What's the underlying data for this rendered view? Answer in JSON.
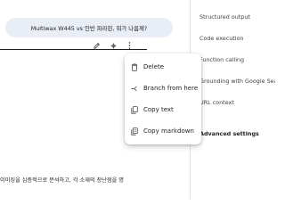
{
  "chat": {
    "user_message": "Multiwax W445 vs 인반 파라핀, 뭐가 나름께?",
    "response_excerpt": "이미징을 심층적으로 분석하고, 각 소재의 장난점을 명"
  },
  "menu": {
    "items": [
      {
        "label": "Delete",
        "icon": "trash-icon"
      },
      {
        "label": "Branch from here",
        "icon": "branch-icon"
      },
      {
        "label": "Copy text",
        "icon": "copy-icon"
      },
      {
        "label": "Copy markdown",
        "icon": "copy-markdown-icon"
      }
    ]
  },
  "side_panel": {
    "structured_output": "Structured output",
    "code_execution": "Code execution",
    "function_calling": "Function calling",
    "grounding": "Grounding with Google Search",
    "url_context": "URL context",
    "advanced_settings": "Advanced settings"
  },
  "colors": {
    "bubble_bg": "#e9eef6",
    "divider": "#e3e3e3",
    "accent": "#0b57d0"
  }
}
